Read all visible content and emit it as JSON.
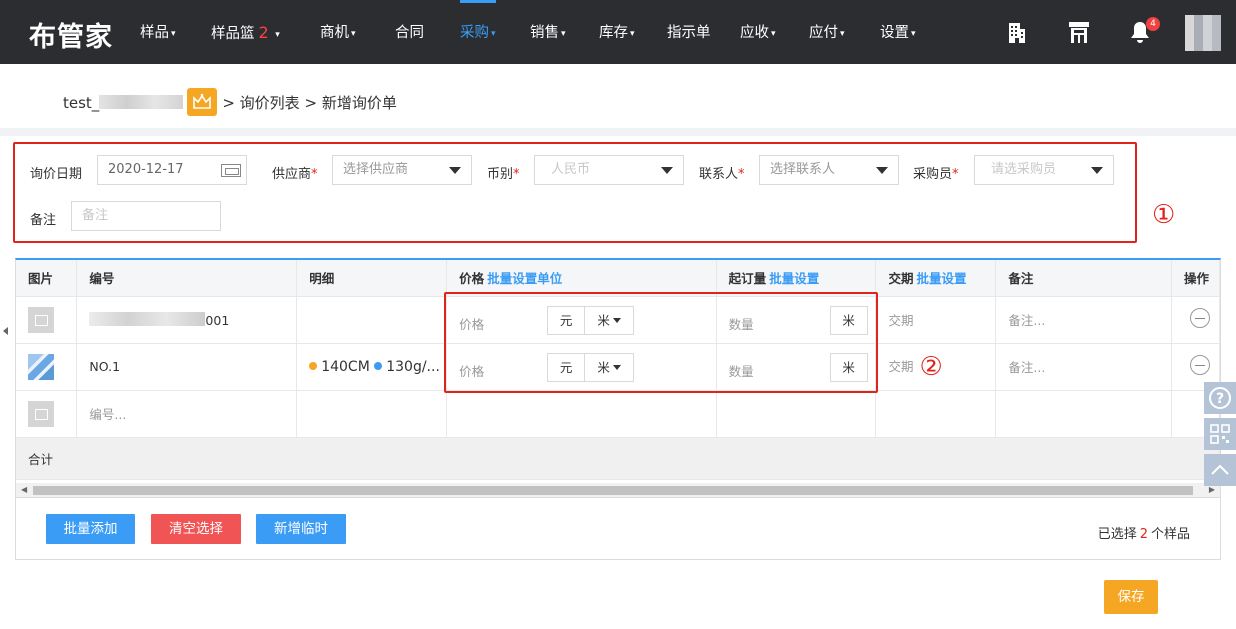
{
  "app": {
    "logo": "布管家"
  },
  "nav": {
    "items": [
      {
        "label": "样品",
        "caret": "▾"
      },
      {
        "label": "样品篮",
        "badge": "2",
        "caret": "▾"
      },
      {
        "label": "商机",
        "caret": "▾"
      },
      {
        "label": "合同",
        "caret": ""
      },
      {
        "label": "采购",
        "caret": "▾",
        "active": true
      },
      {
        "label": "销售",
        "caret": "▾"
      },
      {
        "label": "库存",
        "caret": "▾"
      },
      {
        "label": "指示单",
        "caret": ""
      },
      {
        "label": "应收",
        "caret": "▾"
      },
      {
        "label": "应付",
        "caret": "▾"
      },
      {
        "label": "设置",
        "caret": "▾"
      }
    ],
    "notification_count": "4",
    "accent_color": "#3a9cf5"
  },
  "breadcrumb": {
    "account": "test_",
    "separator": ">",
    "items": [
      "询价列表",
      "新增询价单"
    ]
  },
  "form": {
    "inquiry_date_label": "询价日期",
    "inquiry_date_value": "2020-12-17",
    "supplier_label": "供应商",
    "supplier_placeholder": "选择供应商",
    "currency_label": "币别",
    "currency_value": "人民币",
    "contact_label": "联系人",
    "contact_placeholder": "选择联系人",
    "buyer_label": "采购员",
    "buyer_placeholder": "请选采购员",
    "remark_label": "备注",
    "remark_placeholder": "备注",
    "required_mark": "*"
  },
  "annotations": {
    "circle1": "①",
    "circle2": "②"
  },
  "table": {
    "headers": {
      "image": "图片",
      "code": "编号",
      "detail": "明细",
      "price": "价格",
      "price_link": "批量设置单位",
      "moq": "起订量",
      "moq_link": "批量设置",
      "delivery": "交期",
      "delivery_link": "批量设置",
      "remark": "备注",
      "action": "操作"
    },
    "rows": [
      {
        "code": "001",
        "detail": "",
        "price_placeholder": "价格",
        "currency_unit": "元",
        "price_unit": "米",
        "qty_placeholder": "数量",
        "qty_unit": "米",
        "delivery_placeholder": "交期",
        "remark_placeholder": "备注..."
      },
      {
        "code": "NO.1",
        "detail_1": "140CM",
        "detail_2": "130g/...",
        "price_placeholder": "价格",
        "currency_unit": "元",
        "price_unit": "米",
        "qty_placeholder": "数量",
        "qty_unit": "米",
        "delivery_placeholder": "交期",
        "remark_placeholder": "备注..."
      }
    ],
    "new_row_code_placeholder": "编号...",
    "total_label": "合计",
    "dot_colors": [
      "#f5a623",
      "#3a9cf5"
    ]
  },
  "actions": {
    "batch_add": "批量添加",
    "clear_selection": "清空选择",
    "add_temp": "新增临时",
    "selected_prefix": "已选择",
    "selected_count": "2",
    "selected_suffix": "个样品",
    "save": "保存",
    "colors": {
      "blue": "#3a9cf5",
      "red": "#f05454",
      "orange": "#f5a623"
    }
  }
}
